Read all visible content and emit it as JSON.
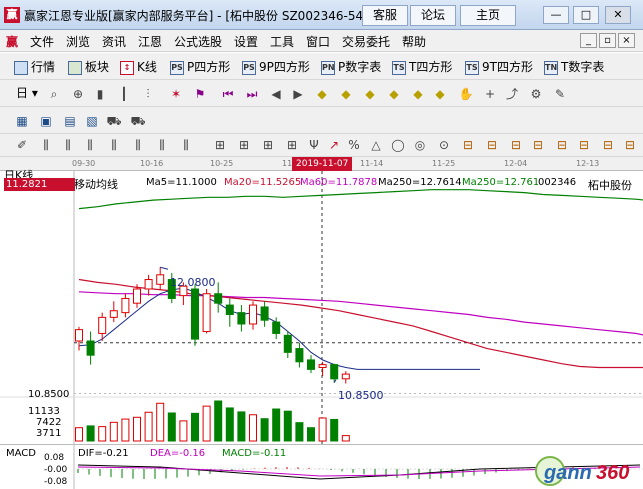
{
  "window": {
    "logo_text": "赢",
    "title": "赢家江恩专业版[赢家内部服务平台] - [柘中股份",
    "code_prefix": "SZ002346-54",
    "buttons": {
      "service": "客服",
      "forum": "论坛",
      "home": "主页"
    },
    "controls": {
      "minimize": "—",
      "maximize": "□",
      "close": "✕"
    }
  },
  "menu": {
    "logo": "赢",
    "items": [
      "文件",
      "浏览",
      "资讯",
      "江恩",
      "公式选股",
      "设置",
      "工具",
      "窗口",
      "交易委托",
      "帮助"
    ],
    "mdi_controls": [
      "_",
      "▫",
      "×"
    ]
  },
  "toolbar1": {
    "items": [
      {
        "icon": "",
        "label": "行情"
      },
      {
        "icon": "",
        "label": "板块"
      },
      {
        "icon": "",
        "label": "K线"
      },
      {
        "icon": "PS",
        "label": "P四方形"
      },
      {
        "icon": "PS",
        "label": "9P四方形"
      },
      {
        "icon": "PN",
        "label": "P数字表"
      },
      {
        "icon": "TS",
        "label": "T四方形"
      },
      {
        "icon": "TS",
        "label": "9T四方形"
      },
      {
        "icon": "TN",
        "label": "T数字表"
      }
    ]
  },
  "toolbar2": {
    "day_label": "日"
  },
  "datebar": {
    "ticks": [
      "09-30",
      "10-16",
      "10-25",
      "11-07",
      "11-14",
      "11-25",
      "12-04",
      "12-13"
    ],
    "current_date": "2019-11-07"
  },
  "chart_header": {
    "period": "日K线",
    "indicator_name": "移动均线",
    "ma5": "Ma5=11.1000",
    "ma20": "Ma20=11.5265",
    "ma60": "Ma60=11.7878",
    "ma250": "Ma250=12.7614",
    "ma250b": "Ma250=12.7614",
    "stock_code": "002346",
    "stock_name": "柘中股份"
  },
  "colors": {
    "ma5": "#000000",
    "ma20": "#c8102e",
    "ma60": "#c000c0",
    "ma250": "#008000",
    "rise": "#e00000",
    "fall": "#008000",
    "ma_line_dark": "#1c2c88"
  },
  "chart_data": {
    "type": "candlestick",
    "price_high_label": "12.0800",
    "price_low_label": "10.8500",
    "price_tag": "11.2821",
    "y_axis_price_label": "10.8500",
    "volume_ticks": [
      "11133",
      "7422",
      "3711"
    ],
    "candles": [
      {
        "o": 11.3,
        "h": 11.45,
        "l": 11.2,
        "c": 11.42
      },
      {
        "o": 11.3,
        "h": 11.4,
        "l": 11.05,
        "c": 11.15
      },
      {
        "o": 11.38,
        "h": 11.6,
        "l": 11.3,
        "c": 11.55
      },
      {
        "o": 11.55,
        "h": 11.72,
        "l": 11.5,
        "c": 11.62
      },
      {
        "o": 11.6,
        "h": 11.8,
        "l": 11.55,
        "c": 11.75
      },
      {
        "o": 11.7,
        "h": 11.9,
        "l": 11.65,
        "c": 11.85
      },
      {
        "o": 11.85,
        "h": 12.0,
        "l": 11.78,
        "c": 11.95
      },
      {
        "o": 11.9,
        "h": 12.08,
        "l": 11.84,
        "c": 12.0
      },
      {
        "o": 11.95,
        "h": 12.02,
        "l": 11.7,
        "c": 11.75
      },
      {
        "o": 11.78,
        "h": 11.92,
        "l": 11.68,
        "c": 11.88
      },
      {
        "o": 11.85,
        "h": 11.9,
        "l": 11.25,
        "c": 11.32
      },
      {
        "o": 11.4,
        "h": 11.85,
        "l": 11.38,
        "c": 11.8
      },
      {
        "o": 11.8,
        "h": 11.92,
        "l": 11.6,
        "c": 11.7
      },
      {
        "o": 11.68,
        "h": 11.75,
        "l": 11.45,
        "c": 11.58
      },
      {
        "o": 11.6,
        "h": 11.68,
        "l": 11.4,
        "c": 11.48
      },
      {
        "o": 11.48,
        "h": 11.72,
        "l": 11.42,
        "c": 11.68
      },
      {
        "o": 11.66,
        "h": 11.72,
        "l": 11.45,
        "c": 11.52
      },
      {
        "o": 11.5,
        "h": 11.55,
        "l": 11.32,
        "c": 11.38
      },
      {
        "o": 11.36,
        "h": 11.4,
        "l": 11.12,
        "c": 11.18
      },
      {
        "o": 11.22,
        "h": 11.28,
        "l": 11.02,
        "c": 11.08
      },
      {
        "o": 11.1,
        "h": 11.15,
        "l": 10.96,
        "c": 11.0
      },
      {
        "o": 11.02,
        "h": 11.08,
        "l": 10.93,
        "c": 11.05
      },
      {
        "o": 11.05,
        "h": 11.06,
        "l": 10.86,
        "c": 10.9
      },
      {
        "o": 10.9,
        "h": 10.98,
        "l": 10.85,
        "c": 10.95
      }
    ],
    "volumes": [
      3700,
      4200,
      4000,
      5200,
      6100,
      6600,
      8000,
      10500,
      7800,
      5600,
      7700,
      9700,
      11133,
      9200,
      8100,
      7300,
      6200,
      8900,
      8300,
      5100,
      3700,
      6400,
      6000,
      1500
    ],
    "ma5_series": [
      11.25,
      11.26,
      11.32,
      11.42,
      11.52,
      11.62,
      11.72,
      11.8,
      11.84,
      11.86,
      11.82,
      11.76,
      11.7,
      11.62,
      11.58,
      11.6,
      11.56,
      11.5,
      11.4,
      11.3,
      11.18,
      11.1,
      11.05,
      11.02,
      11.0,
      11.0,
      11.0,
      11.0,
      11.0,
      11.0,
      11.0,
      11.0,
      11.0
    ],
    "ma20_series": [
      11.95,
      11.92,
      11.9,
      11.87,
      11.85,
      11.83,
      11.8,
      11.78,
      11.76,
      11.74,
      11.72,
      11.7,
      11.68,
      11.65,
      11.62,
      11.58,
      11.54,
      11.5,
      11.46,
      11.4,
      11.34,
      11.28,
      11.22,
      11.18,
      11.14,
      11.1,
      11.06,
      11.03,
      11.02,
      11.02,
      11.02,
      11.02,
      11.02
    ],
    "ma60_series": [
      11.82,
      11.81,
      11.8,
      11.8,
      11.79,
      11.79,
      11.78,
      11.78,
      11.77,
      11.76,
      11.76,
      11.75,
      11.74,
      11.73,
      11.72,
      11.7,
      11.68,
      11.66,
      11.64,
      11.62,
      11.6,
      11.58,
      11.55,
      11.53,
      11.5,
      11.48,
      11.46,
      11.44,
      11.42,
      11.4,
      11.38,
      11.34,
      11.3
    ],
    "ma250_series": [
      12.7,
      12.72,
      12.75,
      12.77,
      12.79,
      12.8,
      12.81,
      12.82,
      12.82,
      12.83,
      12.83,
      12.82,
      12.83,
      12.84,
      12.85,
      12.86,
      12.87,
      12.88,
      12.89,
      12.9,
      12.9,
      12.9,
      12.89,
      12.88,
      12.87,
      12.85,
      12.84,
      12.83,
      12.82,
      12.81,
      12.8,
      12.78,
      12.76
    ],
    "ylim": [
      10.75,
      12.95
    ]
  },
  "macd": {
    "label": "MACD",
    "dif": "DIF=-0.21",
    "dea": "DEA=-0.16",
    "macd": "MACD=-0.11",
    "ticks": [
      "0.08",
      "-0.00",
      "-0.08"
    ]
  },
  "watermark": "gann360"
}
